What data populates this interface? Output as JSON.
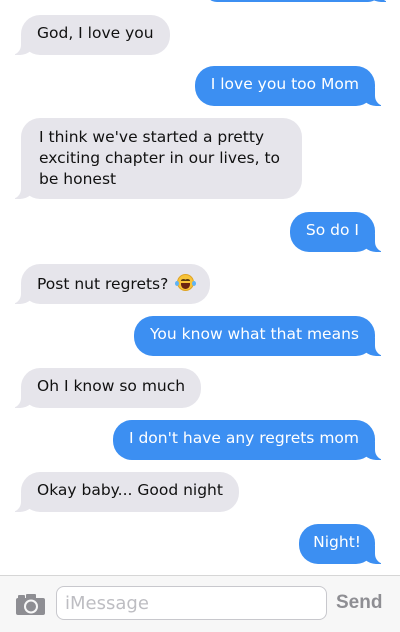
{
  "conversation": {
    "messages": [
      {
        "direction": "outgoing",
        "text": ""
      },
      {
        "direction": "incoming",
        "text": "God, I love you"
      },
      {
        "direction": "outgoing",
        "text": "I love you too Mom"
      },
      {
        "direction": "incoming",
        "text": "I think we've started a pretty exciting chapter in our lives, to be honest"
      },
      {
        "direction": "outgoing",
        "text": "So do I"
      },
      {
        "direction": "incoming",
        "text": "Post nut regrets?",
        "emoji": "face-with-tears-of-joy"
      },
      {
        "direction": "outgoing",
        "text": "You know what that means"
      },
      {
        "direction": "incoming",
        "text": "Oh I know so much"
      },
      {
        "direction": "outgoing",
        "text": "I don't have any regrets mom"
      },
      {
        "direction": "incoming",
        "text": "Okay baby... Good night"
      },
      {
        "direction": "outgoing",
        "text": "Night!"
      }
    ]
  },
  "composer": {
    "camera_icon": "camera-icon",
    "placeholder": "iMessage",
    "send_label": "Send"
  },
  "colors": {
    "incoming_bubble": "#e6e5eb",
    "outgoing_bubble": "#3c8ff2",
    "send_disabled": "#8e8e93"
  }
}
